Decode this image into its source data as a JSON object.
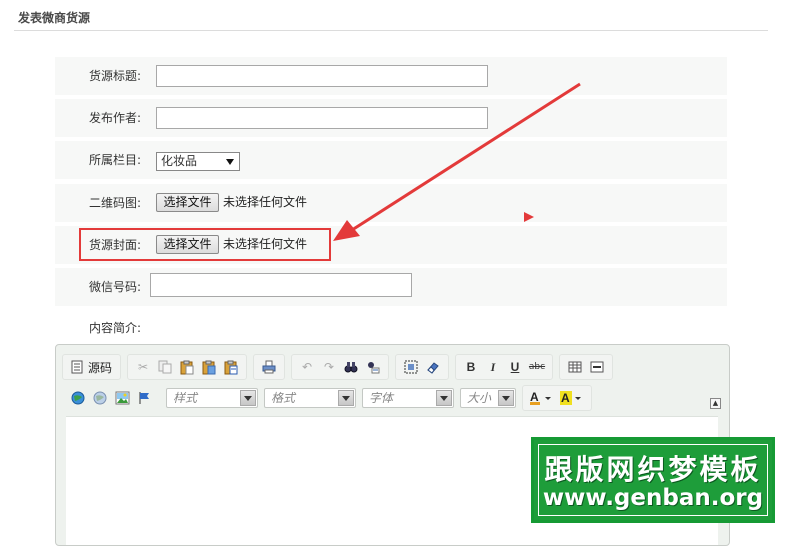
{
  "header": {
    "title": "发表微商货源"
  },
  "form": {
    "title_label": "货源标题:",
    "title_value": "",
    "author_label": "发布作者:",
    "author_value": "",
    "category_label": "所属栏目:",
    "category_selected": "化妆品",
    "qrcode_label": "二维码图:",
    "qrcode_button": "选择文件",
    "qrcode_status": "未选择任何文件",
    "cover_label": "货源封面:",
    "cover_button": "选择文件",
    "cover_status": "未选择任何文件",
    "wechat_label": "微信号码:",
    "wechat_value": "",
    "intro_label": "内容简介:"
  },
  "editor": {
    "source_label": "源码",
    "style_placeholder": "样式",
    "format_placeholder": "格式",
    "font_placeholder": "字体",
    "size_placeholder": "大小",
    "bold_label": "B",
    "italic_label": "I",
    "underline_label": "U",
    "strike_label": "abc"
  },
  "watermark": {
    "line1": "跟版网织梦模板",
    "line2": "www.genban.org"
  },
  "colors": {
    "highlight": "#e33a3a",
    "watermark_bg": "#1e9d3a"
  }
}
